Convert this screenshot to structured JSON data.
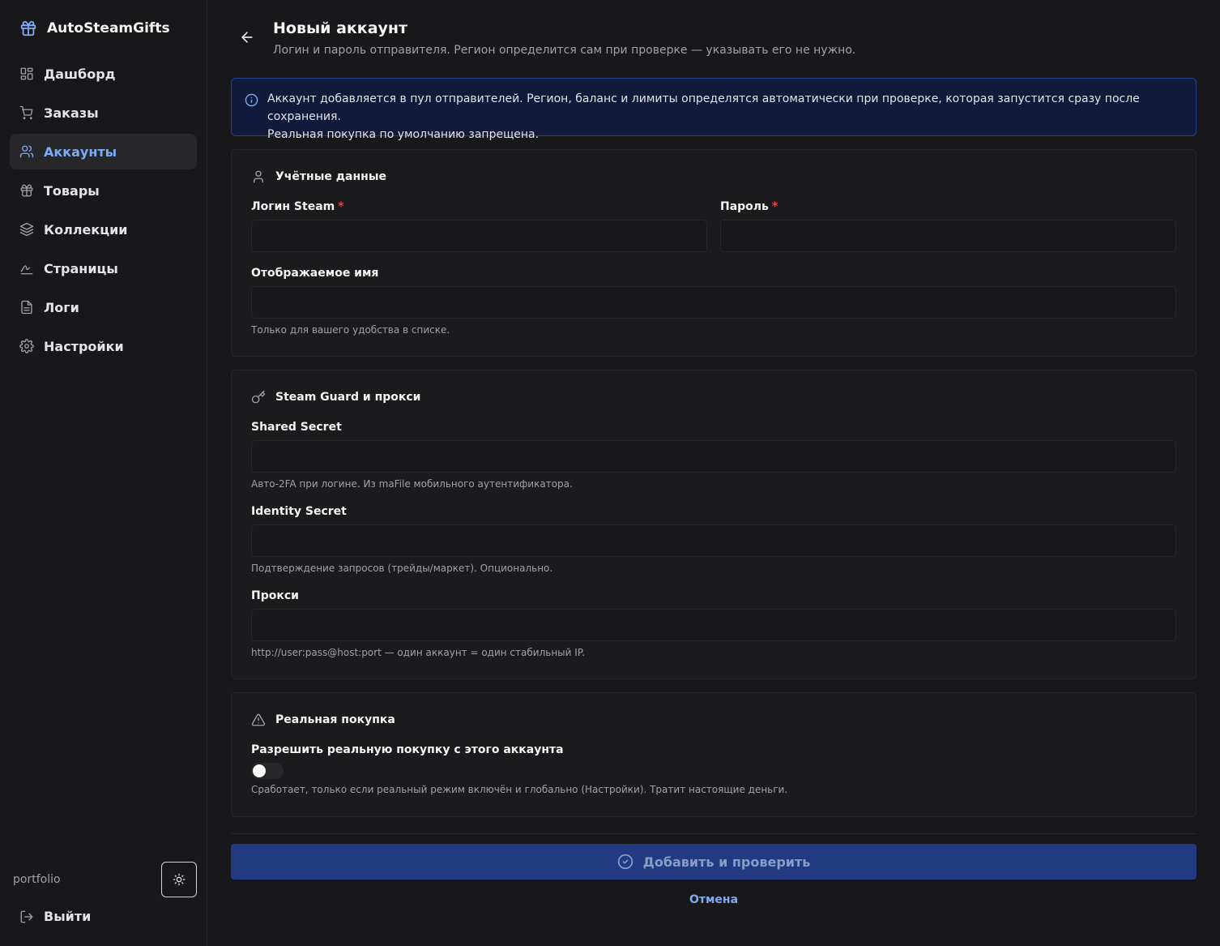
{
  "app": {
    "name": "AutoSteamGifts"
  },
  "sidebar": {
    "items": [
      {
        "label": "Дашборд",
        "icon": "dashboard-icon"
      },
      {
        "label": "Заказы",
        "icon": "cart-icon"
      },
      {
        "label": "Аккаунты",
        "icon": "users-icon",
        "active": true
      },
      {
        "label": "Товары",
        "icon": "gift-icon"
      },
      {
        "label": "Коллекции",
        "icon": "layers-icon"
      },
      {
        "label": "Страницы",
        "icon": "signature-icon"
      },
      {
        "label": "Логи",
        "icon": "file-text-icon"
      },
      {
        "label": "Настройки",
        "icon": "gear-icon"
      }
    ],
    "user": "portfolio",
    "logout_label": "Выйти"
  },
  "page": {
    "title": "Новый аккаунт",
    "subtitle": "Логин и пароль отправителя. Регион определится сам при проверке — указывать его не нужно."
  },
  "info": {
    "line1": "Аккаунт добавляется в пул отправителей. Регион, баланс и лимиты определятся автоматически при проверке, которая запустится сразу после сохранения.",
    "line2": "Реальная покупка по умолчанию запрещена."
  },
  "credentials": {
    "title": "Учётные данные",
    "login_label": "Логин Steam",
    "login_value": "",
    "password_label": "Пароль",
    "password_value": "",
    "required_mark": "*",
    "display_name_label": "Отображаемое имя",
    "display_name_value": "",
    "display_name_hint": "Только для вашего удобства в списке."
  },
  "guard": {
    "title": "Steam Guard и прокси",
    "shared_label": "Shared Secret",
    "shared_value": "",
    "shared_hint": "Авто-2FA при логине. Из maFile мобильного аутентификатора.",
    "identity_label": "Identity Secret",
    "identity_value": "",
    "identity_hint": "Подтверждение запросов (трейды/маркет). Опционально.",
    "proxy_label": "Прокси",
    "proxy_value": "",
    "proxy_hint": "http://user:pass@host:port — один аккаунт = один стабильный IP."
  },
  "real_purchase": {
    "title": "Реальная покупка",
    "toggle_label": "Разрешить реальную покупку с этого аккаунта",
    "enabled": false,
    "hint": "Сработает, только если реальный режим включён и глобально (Настройки). Тратит настоящие деньги."
  },
  "actions": {
    "submit_label": "Добавить и проверить",
    "cancel_label": "Отмена"
  },
  "colors": {
    "background": "#18181b",
    "accent": "#7dabf5",
    "info_bg": "#111a3a",
    "submit_bg": "#213a82",
    "required": "#ef4444"
  }
}
